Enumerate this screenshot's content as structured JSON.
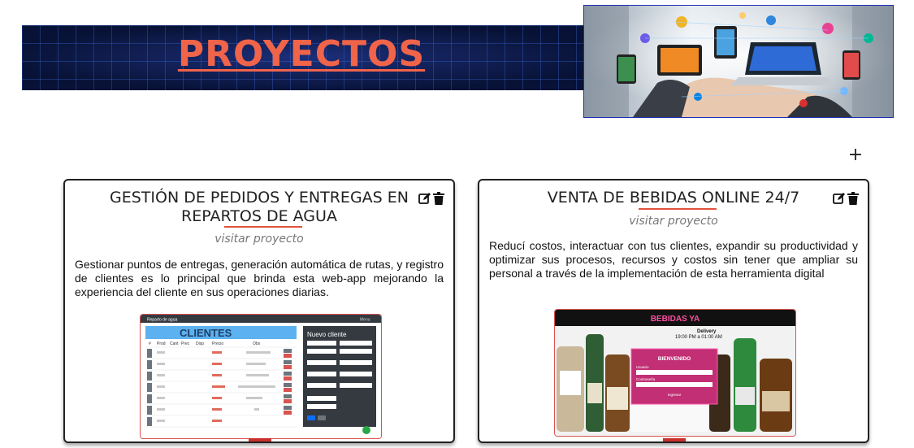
{
  "header": {
    "title": "PROYECTOS"
  },
  "toolbar": {
    "add_label": "+"
  },
  "projects": [
    {
      "title": "GESTIÓN DE PEDIDOS Y ENTREGAS EN REPARTOS DE AGUA",
      "link": "visitar proyecto",
      "description": "Gestionar puntos de entregas, generación automática de rutas, y registro de clientes es lo principal que brinda esta web-app mejorando la experiencia del cliente en sus operaciones diarias.",
      "screenshot": {
        "app_name": "Reparto de agua",
        "menu": "Menu",
        "heading": "CLIENTES",
        "columns": [
          "#",
          "Prod",
          "Cant",
          "Prec",
          "Disp",
          "Precio",
          "Obs"
        ],
        "form_title": "Nuevo cliente"
      }
    },
    {
      "title": "VENTA DE BEBIDAS ONLINE 24/7",
      "link": "visitar proyecto",
      "description": "Reducí costos, interactuar con tus clientes, expandir su productividad y optimizar sus procesos, recursos y costos sin tener que ampliar su personal a través de la implementación de esta herramienta digital",
      "screenshot": {
        "brand": "BEBIDAS YA",
        "delivery_label": "Delivery",
        "delivery_hours": "19:00 PM a 01:00 AM",
        "welcome": "BIENVENIDO",
        "user_label": "Usuario",
        "password_label": "Contraseña",
        "login_button": "Ingresar"
      }
    }
  ],
  "colors": {
    "accent": "#f0644a",
    "banner": "#0b1742",
    "underline": "#e0533b"
  },
  "icons": [
    "plus-icon",
    "edit-icon",
    "trash-icon"
  ]
}
